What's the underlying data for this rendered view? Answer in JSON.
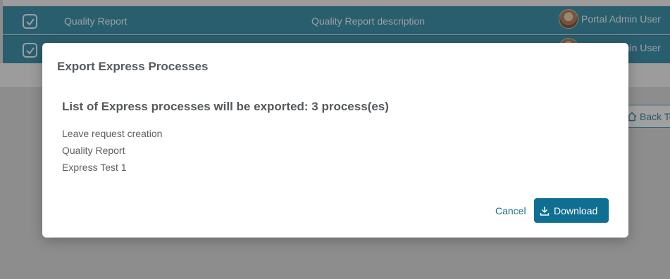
{
  "table": {
    "rows": [
      {
        "name": "Quality Report",
        "description": "Quality Report description",
        "owner": "Portal Admin User"
      },
      {
        "name": "",
        "description": "",
        "owner": "Portal Admin User"
      }
    ]
  },
  "page": {
    "back_label": "Back To"
  },
  "dialog": {
    "title": "Export Express Processes",
    "heading": "List of Express processes will be exported: 3 process(es)",
    "processes": [
      "Leave request creation",
      "Quality Report",
      "Express Test 1"
    ],
    "cancel_label": "Cancel",
    "download_label": "Download"
  },
  "icons": {
    "row_check": "checkbox-checked-icon",
    "download": "download-icon",
    "home": "home-icon"
  },
  "colors": {
    "accent": "#0f6f93",
    "row_background": "#1a7a9a",
    "link": "#1a6f8e"
  }
}
